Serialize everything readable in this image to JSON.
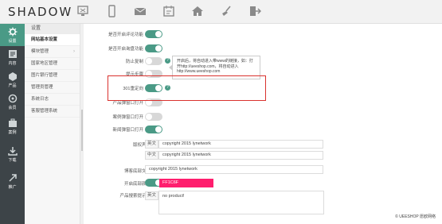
{
  "brand": "SHADOW",
  "top_icons": [
    "monitor-icon",
    "mobile-icon",
    "mail-icon",
    "calendar-icon",
    "home-icon",
    "broom-icon",
    "logout-icon"
  ],
  "left_nav": [
    {
      "icon": "gear-icon",
      "label": "设置",
      "active": true
    },
    {
      "icon": "content-icon",
      "label": "内容"
    },
    {
      "icon": "product-icon",
      "label": "产品"
    },
    {
      "icon": "member-icon",
      "label": "会员"
    },
    {
      "icon": "case-icon",
      "label": "案例"
    },
    {
      "icon": "download-icon",
      "label": "下载"
    },
    {
      "icon": "extend-icon",
      "label": "推广"
    }
  ],
  "submenu": {
    "title": "设置",
    "items": [
      {
        "label": "网站基本设置",
        "active": true
      },
      {
        "label": "模块管理",
        "arrow": "›"
      },
      {
        "label": "国家地区管理"
      },
      {
        "label": "图片银行管理"
      },
      {
        "label": "管理员管理"
      },
      {
        "label": "系统日志"
      },
      {
        "label": "客服管理系统"
      }
    ]
  },
  "settings": [
    {
      "label": "是否开启评论功能",
      "on": true
    },
    {
      "label": "是否开启询盘功能",
      "on": true
    },
    {
      "label": "防止复制",
      "on": false,
      "help": true
    },
    {
      "label": "提示步骤",
      "on": false
    },
    {
      "label": "301重定向",
      "on": true,
      "help": true
    },
    {
      "label": "产品弹窗口打开",
      "on": false
    },
    {
      "label": "案例弹窗口打开",
      "on": false
    },
    {
      "label": "新闻弹窗口打开",
      "on": true
    }
  ],
  "tooltip": "开启后，将自动进入带www的链接，如：打开http://ueeshop.com，将自动进入http://www.ueeshop.com",
  "copyright": {
    "label": "版权声明",
    "en_tag": "英文",
    "en_value": "copyright 2015 lynetwork",
    "zh_tag": "中文",
    "zh_value": "copyright 2015 lynetwork"
  },
  "footer_text": {
    "label": "博客底部文字",
    "value": "copyright 2015 lynetwork"
  },
  "footer_bg": {
    "label": "开启底部颜色",
    "on": true,
    "color": "FF1C6F"
  },
  "product_hint": {
    "label": "产品搜索提示语",
    "tag": "英文",
    "value": "no product!"
  },
  "page_footer": "© UEESHOP 愿欧网络",
  "colors": {
    "accent": "#4a9a86",
    "sidebar": "#3d4448",
    "highlight_border": "#d9322e",
    "pink": "#ff1e6e"
  }
}
